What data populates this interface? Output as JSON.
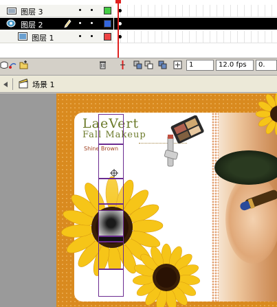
{
  "timeline": {
    "layers": [
      {
        "name": "图层 3",
        "color": "#44cc44",
        "selected": false,
        "icon": "layer-folder-icon"
      },
      {
        "name": "图层 2",
        "color": "#3366dd",
        "selected": true,
        "icon": "layer-mask-icon",
        "editing_icon": "pencil-icon"
      },
      {
        "name": "图层 1",
        "color": "#ee4444",
        "selected": false,
        "icon": "layer-icon"
      }
    ],
    "toolbar": {
      "current_frame": "1",
      "frame_rate": "12.0 fps",
      "elapsed_time": "0."
    }
  },
  "scene": {
    "label": "场景 1"
  },
  "stage": {
    "brand_title": "LaeVert",
    "brand_subtitle": "Fall Makeup",
    "brand_tagline": "Shine     Brown"
  }
}
